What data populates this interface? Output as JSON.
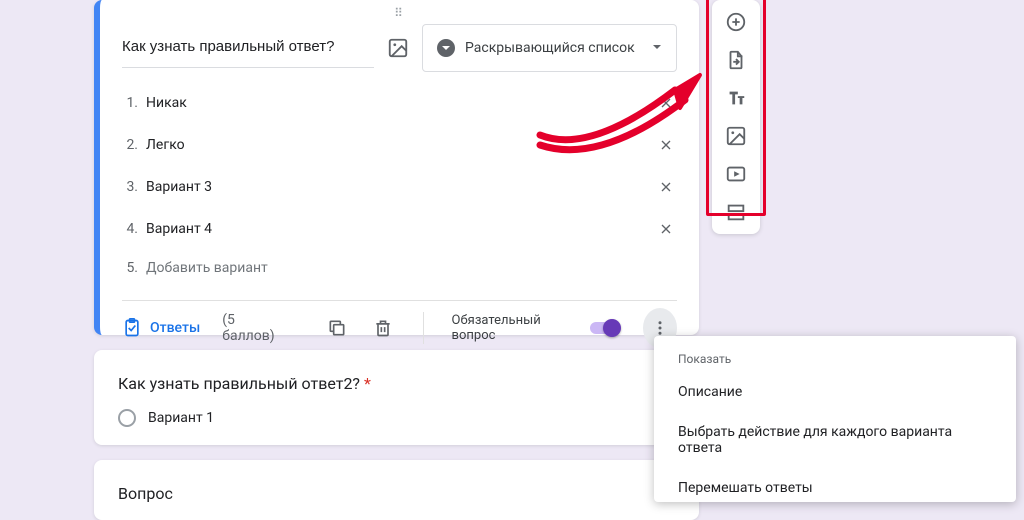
{
  "question1": {
    "title": "Как узнать правильный ответ?",
    "type_label": "Раскрывающийся список",
    "options": [
      {
        "num": "1.",
        "text": "Никак",
        "removable": true
      },
      {
        "num": "2.",
        "text": "Легко",
        "removable": true
      },
      {
        "num": "3.",
        "text": "Вариант 3",
        "removable": true
      },
      {
        "num": "4.",
        "text": "Вариант 4",
        "removable": true
      },
      {
        "num": "5.",
        "text": "Добавить вариант",
        "removable": false,
        "placeholder": true
      }
    ],
    "answer_key_label": "Ответы",
    "points_label": "(5 баллов)",
    "required_label": "Обязательный вопрос",
    "required_on": true
  },
  "question2": {
    "title": "Как узнать правильный ответ2?",
    "required": true,
    "option1": "Вариант 1"
  },
  "question3": {
    "title": "Вопрос"
  },
  "side_toolbar_icons": [
    "add-question",
    "import",
    "add-title",
    "add-image",
    "add-video",
    "add-section"
  ],
  "popup": {
    "section_label": "Показать",
    "items": [
      "Описание",
      "Выбрать действие для каждого варианта ответа",
      "Перемешать ответы"
    ]
  },
  "annotation": {
    "highlight": "side-toolbar",
    "arrow_color": "#e4002b"
  }
}
